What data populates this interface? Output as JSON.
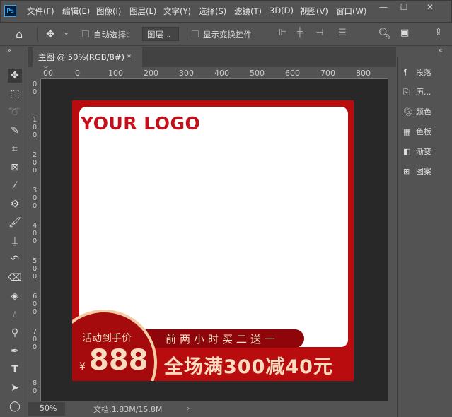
{
  "menu": [
    "文件(F)",
    "编辑(E)",
    "图像(I)",
    "图层(L)",
    "文字(Y)",
    "选择(S)",
    "滤镜(T)",
    "3D(D)",
    "视图(V)",
    "窗口(W)"
  ],
  "window_controls": {
    "minimize": "—",
    "maximize": "☐",
    "close": "✕"
  },
  "options": {
    "auto_select_label": "自动选择：",
    "layer_select": "图层",
    "show_transform_label": "显示变换控件"
  },
  "tab": {
    "title": "主图 @ 50%(RGB/8#) *",
    "close": "×"
  },
  "ruler_top": [
    "00",
    "0",
    "100",
    "200",
    "300",
    "400",
    "500",
    "600",
    "700",
    "800"
  ],
  "ruler_left": [
    "0 0",
    "1 0 0",
    "2 0 0",
    "3 0 0",
    "4 0 0",
    "5 0 0",
    "6 0 0",
    "7 0 0",
    "8 0"
  ],
  "canvas": {
    "logo": "YOUR LOGO",
    "price_label": "活动到手价",
    "currency": "¥",
    "price": "888",
    "banner": "前两小时买二送一",
    "promo": "全场满300减40元",
    "accent": "#b80c0f",
    "gold": "#f4cda6"
  },
  "status": {
    "zoom": "50%",
    "doc": "文档:1.83M/15.8M",
    "arrow": "›"
  },
  "panels": [
    {
      "icon": "paragraph-icon",
      "label": "段落"
    },
    {
      "icon": "history-icon",
      "label": "历..."
    },
    {
      "icon": "color-icon",
      "label": "颜色"
    },
    {
      "icon": "swatches-icon",
      "label": "色板"
    },
    {
      "icon": "gradient-icon",
      "label": "渐变"
    },
    {
      "icon": "pattern-icon",
      "label": "图案"
    }
  ]
}
